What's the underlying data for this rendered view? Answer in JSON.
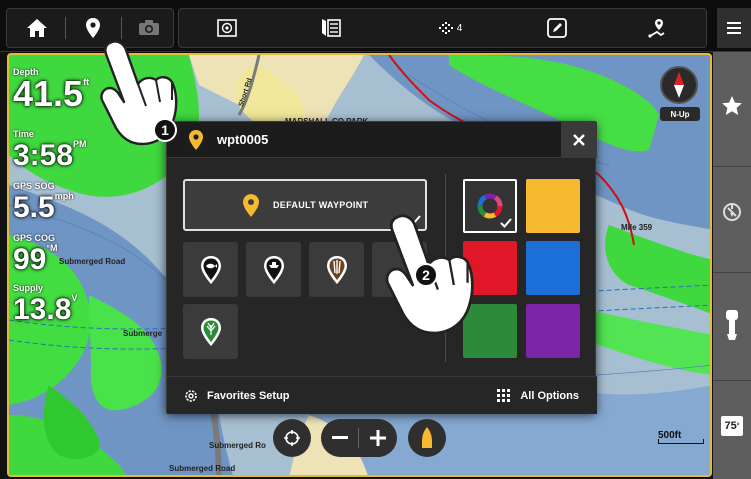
{
  "topbar": {
    "home_icon": "home-icon",
    "waypoint_icon": "waypoint-pin-icon",
    "camera_icon": "camera-icon",
    "sonar_icon": "sonar-icon",
    "chart_icon": "chart-book-icon",
    "satellites_count": "4",
    "edit_icon": "edit-icon",
    "route_icon": "route-icon",
    "menu_icon": "hamburger-menu-icon"
  },
  "sidebar": {
    "favorites_icon": "star-icon",
    "autopilot_icon": "autopilot-icon",
    "motor_icon": "outboard-motor-icon",
    "temperature": "75"
  },
  "map": {
    "labels": [
      {
        "text": "MARSHALL CO PARK"
      },
      {
        "text": "Short Rd"
      },
      {
        "text": "Submerged Road"
      },
      {
        "text": "Submerge"
      },
      {
        "text": "Submerged Ro"
      },
      {
        "text": "Submerged Road"
      },
      {
        "text": "Mile 359"
      }
    ],
    "readouts": [
      {
        "label": "Depth",
        "value": "41.5",
        "unit": "ft"
      },
      {
        "label": "Time",
        "value": "3:58",
        "unit": "PM"
      },
      {
        "label": "GPS SOG",
        "value": "5.5",
        "unit": "mph"
      },
      {
        "label": "GPS COG",
        "value": "99",
        "unit": "°M"
      },
      {
        "label": "Supply",
        "value": "13.8",
        "unit": "V"
      }
    ],
    "compass_mode": "N-Up",
    "scale": "500ft"
  },
  "dialog": {
    "title": "wpt0005",
    "close_icon": "close-icon",
    "default_waypoint_label": "DEFAULT WAYPOINT",
    "icons": [
      "fish-waypoint-icon",
      "boat-waypoint-icon",
      "structure-waypoint-icon",
      "vegetation-waypoint-icon"
    ],
    "colors": [
      {
        "name": "multicolor",
        "hex": "#333333",
        "selected": true
      },
      {
        "name": "yellow",
        "hex": "#f6b92f"
      },
      {
        "name": "red",
        "hex": "#e01728"
      },
      {
        "name": "blue",
        "hex": "#1c6fd6"
      },
      {
        "name": "green",
        "hex": "#2d8a3a"
      },
      {
        "name": "purple",
        "hex": "#7b24a6"
      }
    ],
    "favorites_setup_label": "Favorites Setup",
    "all_options_label": "All Options"
  },
  "annotations": {
    "step1": "1",
    "step2": "2"
  }
}
